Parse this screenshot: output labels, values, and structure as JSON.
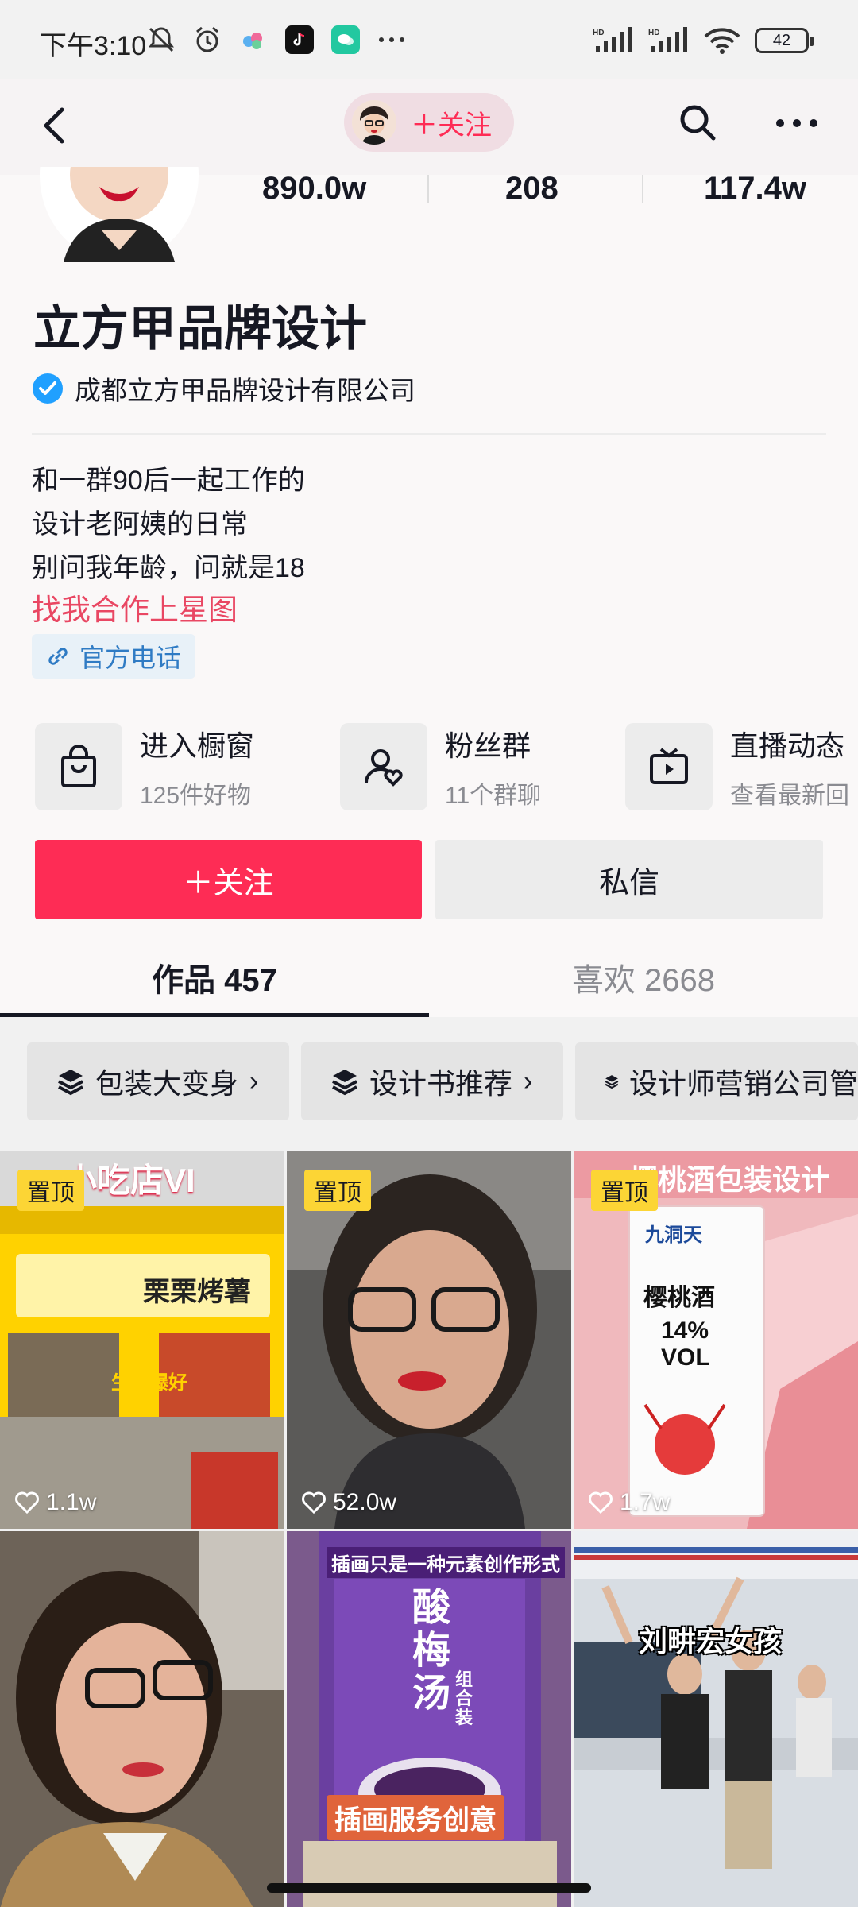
{
  "status_bar": {
    "time": "下午3:10",
    "battery": "42",
    "icons": [
      "mute-icon",
      "alarm-icon",
      "cloud-app-icon",
      "douyin-app-icon",
      "wechat-app-icon",
      "more-dots-icon",
      "signal-hd-icon",
      "signal-hd-icon",
      "wifi-icon",
      "battery-icon"
    ]
  },
  "header": {
    "follow_label": "＋关注"
  },
  "profile": {
    "stats": [
      "890.0w",
      "208",
      "117.4w"
    ],
    "name": "立方甲品牌设计",
    "verified_company": "成都立方甲品牌设计有限公司",
    "bio_lines": [
      "和一群90后一起工作的",
      "设计老阿姨的日常",
      "别问我年龄，问就是18"
    ],
    "bio_link": "找我合作上星图",
    "phone_tag": "官方电话"
  },
  "services": [
    {
      "title": "进入橱窗",
      "sub": "125件好物",
      "icon": "bag-icon"
    },
    {
      "title": "粉丝群",
      "sub": "11个群聊",
      "icon": "fans-group-icon"
    },
    {
      "title": "直播动态",
      "sub": "查看最新回",
      "icon": "tv-icon"
    }
  ],
  "actions": {
    "follow": "＋关注",
    "message": "私信"
  },
  "tabs": [
    {
      "label": "作品 457",
      "active": true
    },
    {
      "label": "喜欢 2668",
      "active": false
    }
  ],
  "collections": [
    {
      "label": "包装大变身"
    },
    {
      "label": "设计书推荐"
    },
    {
      "label": "设计师营销公司管"
    }
  ],
  "videos": [
    {
      "pinned": "置顶",
      "likes": "1.1w",
      "title": "小吃店VI",
      "sign": "栗栗烤薯",
      "caption": "生意爆好"
    },
    {
      "pinned": "置顶",
      "likes": "52.0w"
    },
    {
      "pinned": "置顶",
      "likes": "1.7w",
      "title": "樱桃酒包装设计",
      "brand": "九洞天",
      "product": "樱桃酒",
      "abv": "14% VOL"
    },
    {},
    {
      "title": "插画只是一种元素创作形式",
      "product": "酸梅汤",
      "sub": "组合装",
      "caption": "插画服务创意"
    },
    {
      "caption": "刘畊宏女孩"
    }
  ],
  "colors": {
    "accent": "#fe2c55",
    "link": "#e94763",
    "verify": "#20a0ff",
    "pin": "#fcd535"
  }
}
